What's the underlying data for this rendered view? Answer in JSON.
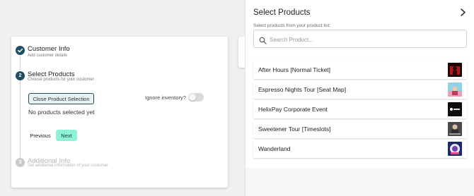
{
  "stepper": {
    "steps": [
      {
        "title": "Customer Info",
        "subtitle": "Add customer details"
      },
      {
        "title": "Select Products",
        "subtitle": "Choose products for your customer",
        "number": "2"
      },
      {
        "title": "Additional Info",
        "subtitle": "Set additional information of your customer",
        "number": "3"
      }
    ],
    "close_selection_label": "Close Product Selection",
    "ignore_inventory_label": "Ignore inventory?",
    "ignore_inventory_on": false,
    "empty_state": "No products selected yet",
    "previous_label": "Previous",
    "next_label": "Next"
  },
  "panel": {
    "title": "Select Products",
    "hint": "Select products from your product list:",
    "search_placeholder": "Search Product...",
    "products": [
      {
        "name": "After Hours [Normal Ticket]"
      },
      {
        "name": "Espresso Nights Tour [Seat Map]"
      },
      {
        "name": "HelixPay Corporate Event"
      },
      {
        "name": "Sweetener Tour [Timeslots]"
      },
      {
        "name": "Wanderland"
      }
    ]
  },
  "colors": {
    "accent": "#1f4e63",
    "next_button": "#8ef2d6"
  }
}
